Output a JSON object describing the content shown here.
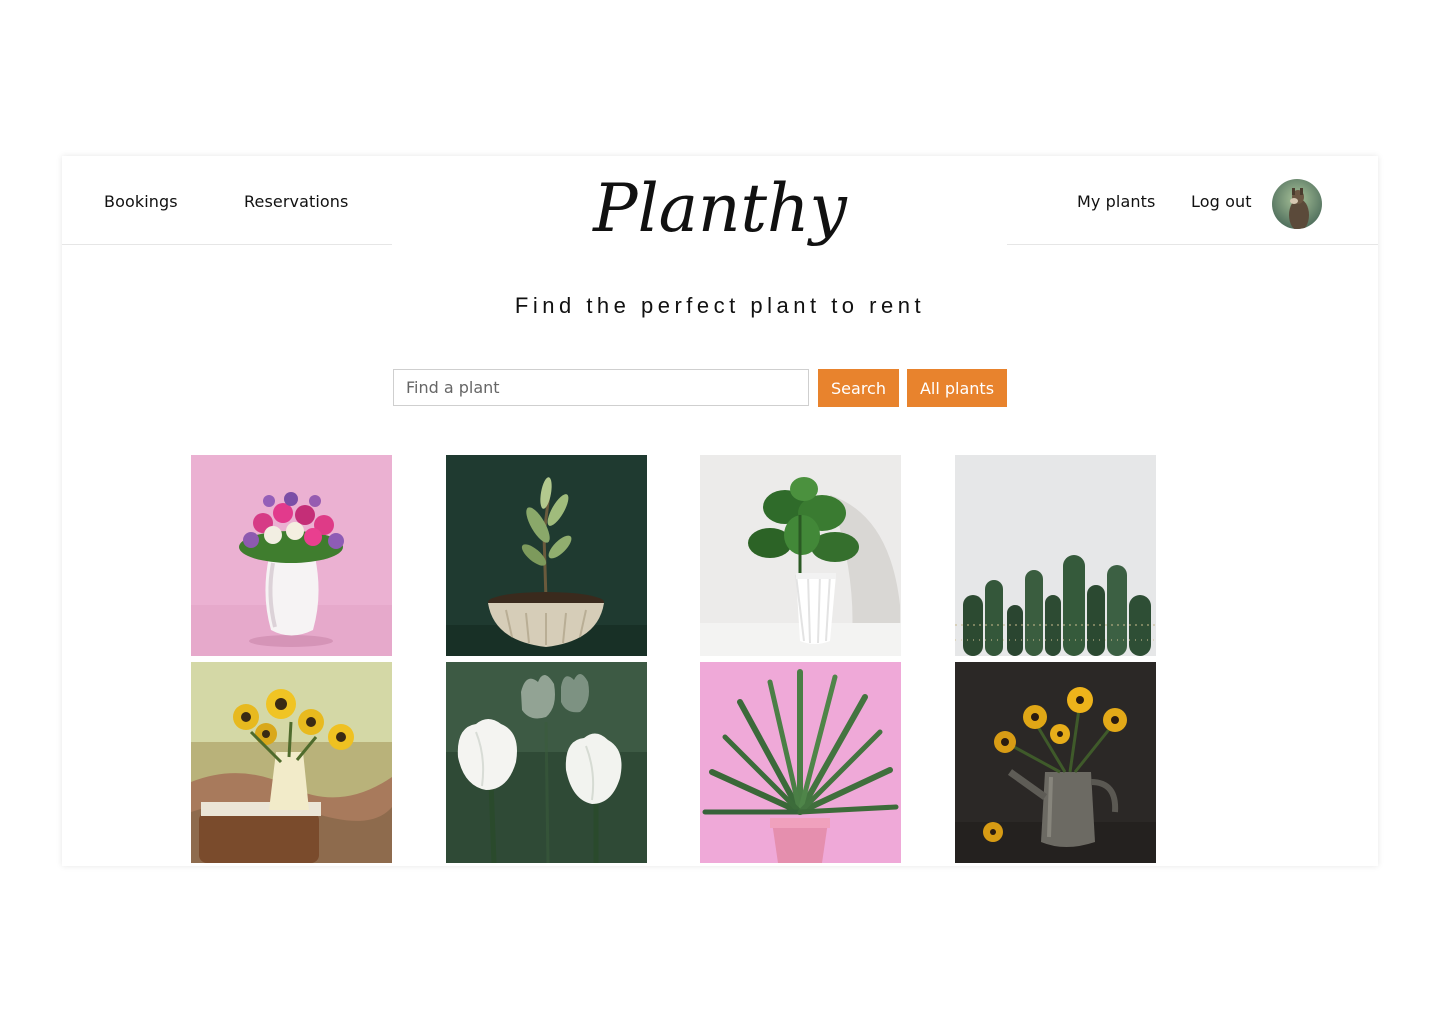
{
  "nav": {
    "left": [
      "Bookings",
      "Reservations"
    ],
    "brand": "Planthy",
    "right": [
      "My plants",
      "Log out"
    ]
  },
  "hero": {
    "tagline": "Find the perfect plant to rent"
  },
  "search": {
    "placeholder": "Find a plant",
    "search_label": "Search",
    "all_label": "All plants"
  },
  "colors": {
    "accent": "#e8832d"
  },
  "plants": [
    {
      "image": "pink-tulips-roses-white-vase"
    },
    {
      "image": "sapling-in-ribbed-bowl"
    },
    {
      "image": "monstera-white-pot"
    },
    {
      "image": "cactus-row"
    },
    {
      "image": "sunflowers-in-basket"
    },
    {
      "image": "white-tulips"
    },
    {
      "image": "aloe-pink-pot"
    },
    {
      "image": "yellow-flowers-watering-can"
    }
  ]
}
